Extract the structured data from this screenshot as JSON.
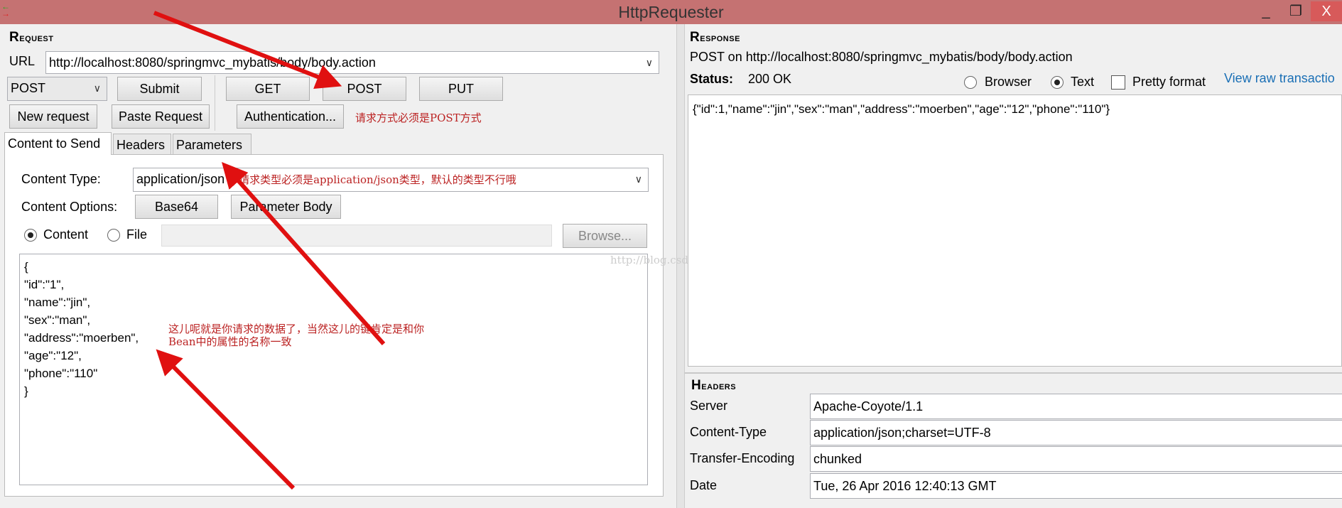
{
  "window": {
    "title": "HttpRequester",
    "minimize": "_",
    "restore": "❐",
    "close": "X"
  },
  "request": {
    "heading": "Request",
    "url_label": "URL",
    "url": "http://localhost:8080/springmvc_mybatis/body/body.action",
    "method_select": "POST",
    "buttons": {
      "submit": "Submit",
      "get": "GET",
      "post": "POST",
      "put": "PUT",
      "new_request": "New request",
      "paste_request": "Paste Request",
      "authentication": "Authentication..."
    },
    "tabs": [
      "Content to Send",
      "Headers",
      "Parameters"
    ],
    "content_type_label": "Content Type:",
    "content_type": "application/json",
    "content_options_label": "Content Options:",
    "base64": "Base64",
    "parameter_body": "Parameter Body",
    "radio_content": "Content",
    "radio_file": "File",
    "browse": "Browse...",
    "body_lines": [
      "{",
      "\"id\":\"1\",",
      "\"name\":\"jin\",",
      "\"sex\":\"man\",",
      "\"address\":\"moerben\",",
      "\"age\":\"12\",",
      "\"phone\":\"110\"",
      "}"
    ]
  },
  "annotations": {
    "method_note": "请求方式必须是POST方式",
    "content_type_note": "请求类型必须是application/json类型，默认的类型不行哦",
    "body_note_1": "这儿呢就是你请求的数据了，当然这儿的键肯定是和你",
    "body_note_2": "Bean中的属性的名称一致",
    "watermark": "http://blog.csdn.net/"
  },
  "response": {
    "heading": "Response",
    "summary": "POST on http://localhost:8080/springmvc_mybatis/body/body.action",
    "status_label": "Status:",
    "status": "200 OK",
    "view_browser": "Browser",
    "view_text": "Text",
    "pretty_format": "Pretty format",
    "view_raw": "View raw transactio",
    "body": "{\"id\":1,\"name\":\"jin\",\"sex\":\"man\",\"address\":\"moerben\",\"age\":\"12\",\"phone\":\"110\"}",
    "headers_heading": "Headers",
    "headers": [
      {
        "name": "Server",
        "value": "Apache-Coyote/1.1"
      },
      {
        "name": "Content-Type",
        "value": "application/json;charset=UTF-8"
      },
      {
        "name": "Transfer-Encoding",
        "value": "chunked"
      },
      {
        "name": "Date",
        "value": "Tue, 26 Apr 2016 12:40:13 GMT"
      }
    ]
  },
  "colors": {
    "titlebar": "#c57272",
    "annotation": "#b22222",
    "link": "#1a6fb5"
  }
}
